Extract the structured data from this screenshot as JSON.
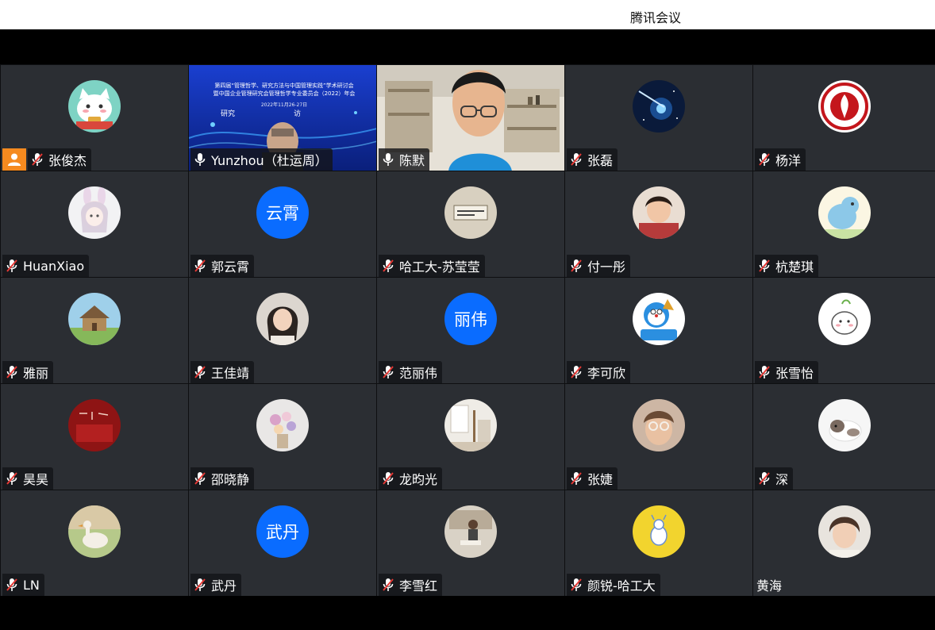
{
  "window": {
    "title": "腾讯会议"
  },
  "slide": {
    "line1": "第四届“管理哲学、研究方法与中国管理实践”学术研讨会",
    "line2": "暨中国企业管理研究会管理哲学专业委员会（2022）年会",
    "line3": "2022年11月26-27日",
    "line4": "研究",
    "line5": "访"
  },
  "participants": [
    {
      "name": "张俊杰",
      "mic": "muted",
      "host": true,
      "avatar": "cat-cartoon-icon"
    },
    {
      "name": "Yunzhou（杜运周）",
      "mic": "on",
      "avatar": "slide-video"
    },
    {
      "name": "陈默",
      "mic": "on",
      "avatar": "camera-video"
    },
    {
      "name": "张磊",
      "mic": "muted",
      "avatar": "galaxy-icon"
    },
    {
      "name": "杨洋",
      "mic": "muted",
      "avatar": "university-seal-icon"
    },
    {
      "name": "HuanXiao",
      "mic": "muted",
      "avatar": "anime-girl-icon"
    },
    {
      "name": "郭云霄",
      "mic": "muted",
      "avatar_text": "云霄"
    },
    {
      "name": "哈工大-苏莹莹",
      "mic": "muted",
      "avatar": "sign-photo-icon"
    },
    {
      "name": "付一彤",
      "mic": "muted",
      "avatar": "child-photo-icon"
    },
    {
      "name": "杭楚琪",
      "mic": "muted",
      "avatar": "dinosaur-cartoon-icon"
    },
    {
      "name": "雅丽",
      "mic": "muted",
      "avatar": "house-painting-icon"
    },
    {
      "name": "王佳靖",
      "mic": "muted",
      "avatar": "portrait-icon"
    },
    {
      "name": "范丽伟",
      "mic": "muted",
      "avatar_text": "丽伟"
    },
    {
      "name": "李可欣",
      "mic": "muted",
      "avatar": "doraemon-2022-icon"
    },
    {
      "name": "张雪怡",
      "mic": "muted",
      "avatar": "sticker-cartoon-icon"
    },
    {
      "name": "昊昊",
      "mic": "muted",
      "avatar": "red-art-icon"
    },
    {
      "name": "邵晓静",
      "mic": "muted",
      "avatar": "flowers-photo-icon"
    },
    {
      "name": "龙昀光",
      "mic": "muted",
      "avatar": "room-photo-icon"
    },
    {
      "name": "张婕",
      "mic": "muted",
      "avatar": "good-child-photo-icon"
    },
    {
      "name": "深",
      "mic": "muted",
      "avatar": "cat-photo-icon"
    },
    {
      "name": "LN",
      "mic": "muted",
      "avatar": "goose-icon"
    },
    {
      "name": "武丹",
      "mic": "muted",
      "avatar_text": "武丹"
    },
    {
      "name": "李雪红",
      "mic": "muted",
      "avatar": "seated-person-photo-icon"
    },
    {
      "name": "颜锐-哈工大",
      "mic": "muted",
      "avatar": "yellow-cartoon-icon"
    },
    {
      "name": "黄海",
      "mic": "none",
      "avatar": "person-photo-icon"
    }
  ],
  "colors": {
    "tile_bg": "#2b2e33",
    "text_avatar_bg": "#0a6cff",
    "host_badge": "#f58a1f",
    "muted_slash": "#e53935"
  }
}
